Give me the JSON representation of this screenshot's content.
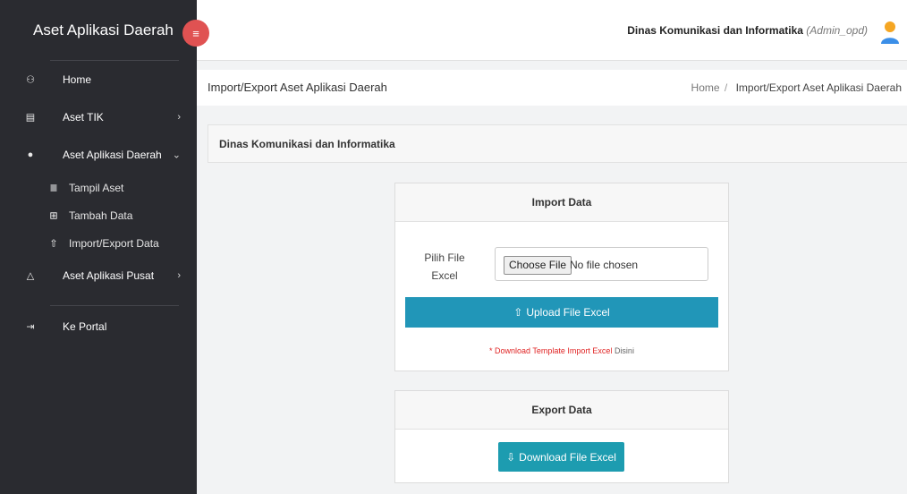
{
  "sidebar": {
    "brand_title": "Aset Aplikasi Daerah",
    "toggle_icon": "menu-toggle-icon",
    "items": [
      {
        "label": "Home",
        "icon": "dashboard-icon",
        "glyph": "⚇"
      },
      {
        "label": "Aset TIK",
        "icon": "briefcase-icon",
        "glyph": "▤",
        "arrow": "›"
      },
      {
        "label": "Aset Aplikasi Daerah",
        "icon": "android-icon",
        "glyph": "●",
        "arrow": "⌄"
      },
      {
        "label": "Aset Aplikasi Pusat",
        "icon": "linux-icon",
        "glyph": "△",
        "arrow": "›"
      },
      {
        "label": "Ke Portal",
        "icon": "sign-in-icon",
        "glyph": "⇥"
      }
    ],
    "sub_items": [
      {
        "label": "Tampil Aset",
        "icon": "list-icon",
        "glyph": "≣"
      },
      {
        "label": "Tambah Data",
        "icon": "plus-square-icon",
        "glyph": "⊞"
      },
      {
        "label": "Import/Export Data",
        "icon": "upload-icon",
        "glyph": "⇧"
      }
    ]
  },
  "topbar": {
    "user_org": "Dinas Komunikasi dan Informatika",
    "user_role": "(Admin_opd)"
  },
  "page_header": {
    "title": "Import/Export Aset Aplikasi Daerah",
    "breadcrumb_home": "Home",
    "breadcrumb_sep": "/",
    "breadcrumb_current": "Import/Export Aset Aplikasi Daerah"
  },
  "org_bar": {
    "title": "Dinas Komunikasi dan Informatika"
  },
  "import_panel": {
    "title": "Import Data",
    "file_label_1": "Pilih File",
    "file_label_2": "Excel",
    "choose_button": "Choose File",
    "no_file": "No file chosen",
    "upload_button": "Upload File Excel",
    "template_text_red": "* Download Template Import Excel",
    "template_text_grey": " Disini"
  },
  "export_panel": {
    "title": "Export Data",
    "download_button": "Download File Excel"
  },
  "colors": {
    "sidebar_bg": "#2a2b30",
    "toggle": "#e05252",
    "upload_button": "#2196b8",
    "download_button": "#1d9cb0",
    "link_red": "#e02424"
  }
}
